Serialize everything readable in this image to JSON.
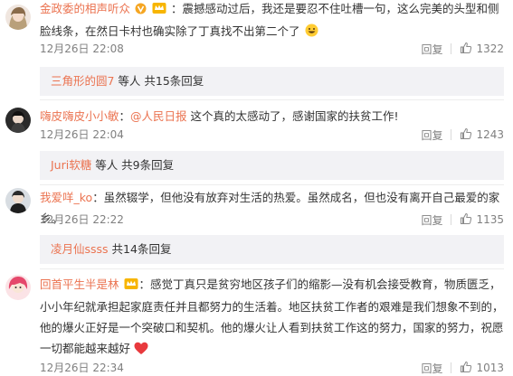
{
  "comments": [
    {
      "username": "金政委的相声听众",
      "separator": "：",
      "text": "震撼感动过后，我还是要忍不住吐槽一句，这么完美的头型和侧脸线条，在然日卡村也确实除了丁真找不出第二个了",
      "time": "12月26日 22:08",
      "reply_label": "回复",
      "likes": "1322",
      "sub_user": "三角形的圆7",
      "sub_summary": " 等人 共15条回复"
    },
    {
      "username": "嗨皮嗨皮小小敏",
      "separator": "：",
      "mention": "@人民日报",
      "text": " 这个真的太感动了，感谢国家的扶贫工作!",
      "time": "12月26日 22:04",
      "reply_label": "回复",
      "likes": "1243",
      "sub_user": "Juri软糖",
      "sub_summary": " 等人 共9条回复"
    },
    {
      "username": "我爱咩_ko",
      "separator": "：",
      "text": "虽然辍学，但他没有放弃对生活的热爱。虽然成名，但也没有离开自己最爱的家乡。",
      "time": "12月26日 22:22",
      "reply_label": "回复",
      "likes": "1135",
      "sub_user": "凌月仙ssss",
      "sub_summary": " 共14条回复"
    },
    {
      "username": "回首平生半是林",
      "separator": "：",
      "text": "感觉丁真只是贫穷地区孩子们的缩影—没有机会接受教育，物质匮乏，小小年纪就承担起家庭责任并且都努力的生活着。地区扶贫工作者的艰难是我们想象不到的，他的爆火正好是一个突破口和契机。他的爆火让人看到扶贫工作这的努力，国家的努力，祝愿一切都能越来越好",
      "time": "12月26日 22:34",
      "reply_label": "回复",
      "likes": "1013"
    }
  ],
  "colors": {
    "username": "#eb7350",
    "meta": "#808080",
    "sub_bg": "#f2f2f5",
    "heart": "#e8393d",
    "badge_v": "#f5a623"
  }
}
